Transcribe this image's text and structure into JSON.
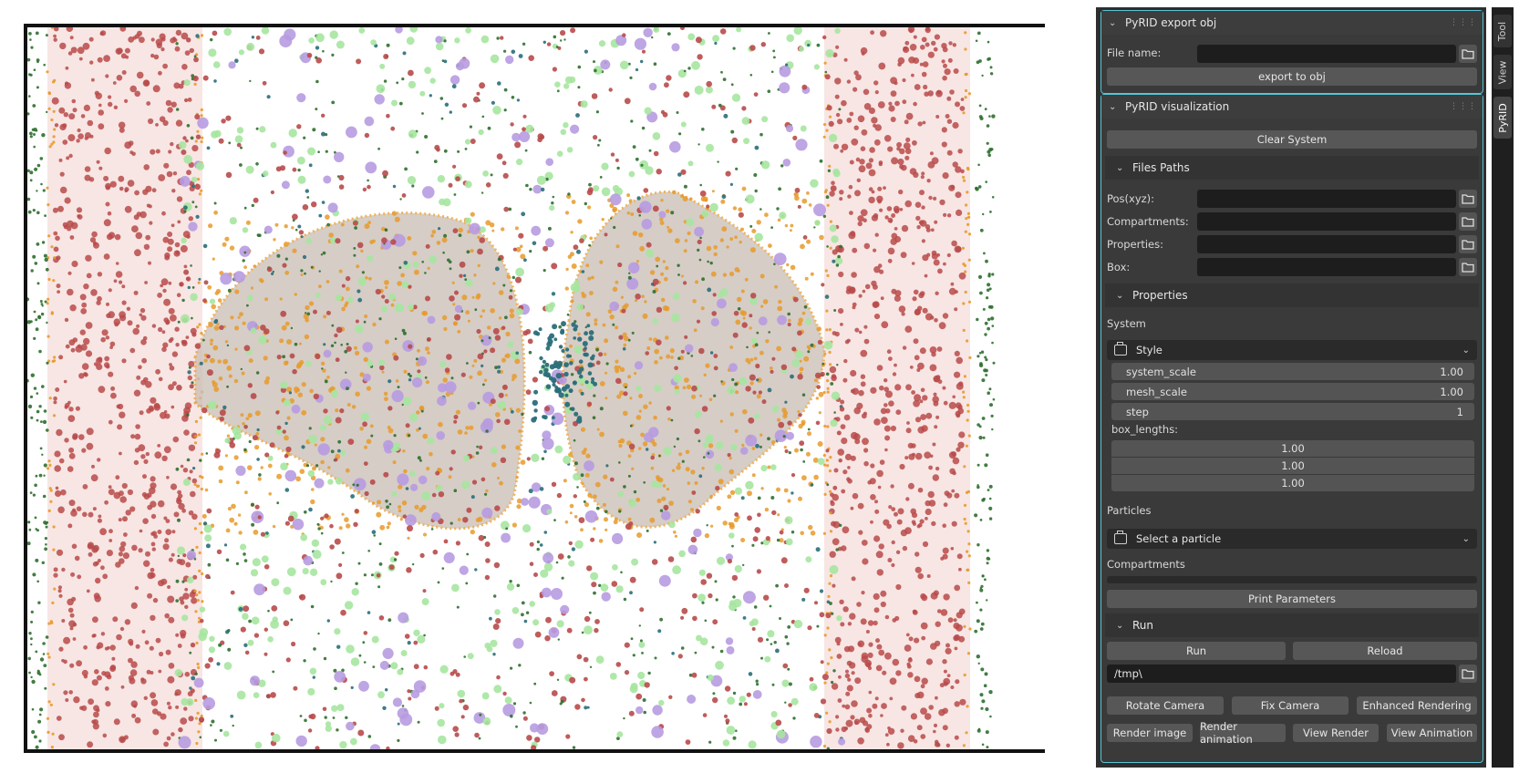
{
  "render": {
    "colors": {
      "membrane_red": "#b84a4a",
      "orange": "#e89a2a",
      "light_green": "#a6e6a0",
      "dark_green": "#2f6f2f",
      "violet": "#b79be0",
      "teal": "#2a6e7a",
      "mesh_grey": "#c9bdb4"
    }
  },
  "tabs": [
    "Tool",
    "View",
    "PyRID"
  ],
  "export_panel": {
    "title": "PyRID export obj",
    "file_name_label": "File name:",
    "file_name_value": "",
    "export_button": "export to obj"
  },
  "viz_panel": {
    "title": "PyRID visualization",
    "clear_button": "Clear System",
    "files_paths": {
      "title": "Files Paths",
      "pos_label": "Pos(xyz):",
      "compartments_label": "Compartments:",
      "properties_label": "Properties:",
      "box_label": "Box:"
    },
    "properties": {
      "title": "Properties",
      "system_label": "System",
      "style_dropdown": "Style",
      "system_scale_label": "system_scale",
      "system_scale_value": "1.00",
      "mesh_scale_label": "mesh_scale",
      "mesh_scale_value": "1.00",
      "step_label": "step",
      "step_value": "1",
      "box_lengths_label": "box_lengths:",
      "box_lengths": [
        "1.00",
        "1.00",
        "1.00"
      ],
      "particles_label": "Particles",
      "particle_dropdown": "Select a particle",
      "compartments_label": "Compartments",
      "print_button": "Print Parameters"
    },
    "run": {
      "title": "Run",
      "run_button": "Run",
      "reload_button": "Reload",
      "path_value": "/tmp\\",
      "rotate_camera": "Rotate Camera",
      "fix_camera": "Fix Camera",
      "enhanced_rendering": "Enhanced Rendering",
      "render_image": "Render image",
      "render_animation": "Render animation",
      "view_render": "View Render",
      "view_animation": "View Animation"
    }
  }
}
